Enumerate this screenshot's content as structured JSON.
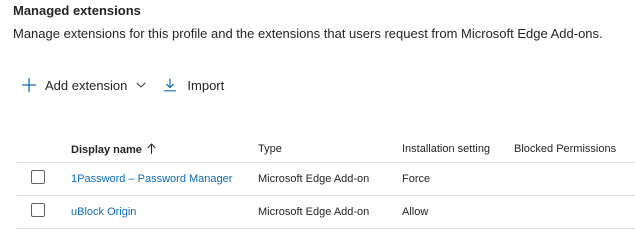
{
  "section": {
    "title": "Managed extensions",
    "description": "Manage extensions for this profile and the extensions that users request from Microsoft Edge Add-ons."
  },
  "toolbar": {
    "add_label": "Add extension",
    "import_label": "Import",
    "add_icon": "plus-icon",
    "dropdown_icon": "chevron-down-icon",
    "import_icon": "download-icon"
  },
  "table": {
    "columns": {
      "name": "Display name",
      "type": "Type",
      "install": "Installation setting",
      "blocked": "Blocked Permissions"
    },
    "sort": {
      "column": "Display name",
      "direction": "ascending",
      "icon": "arrow-up-icon"
    },
    "rows": [
      {
        "name": "1Password – Password Manager",
        "type": "Microsoft Edge Add-on",
        "install": "Force",
        "blocked": ""
      },
      {
        "name": "uBlock Origin",
        "type": "Microsoft Edge Add-on",
        "install": "Allow",
        "blocked": ""
      }
    ]
  },
  "colors": {
    "link": "#0f6cbd",
    "text": "#242424",
    "divider": "#e0e0e0"
  }
}
